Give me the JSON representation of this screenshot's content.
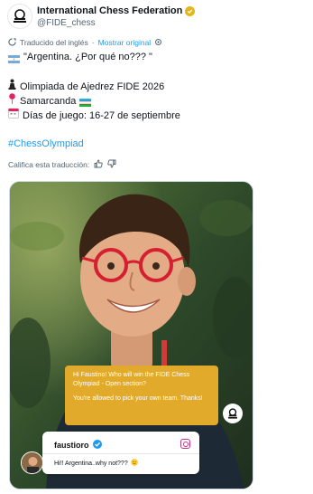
{
  "tweet": {
    "author": {
      "display_name": "International Chess Federation",
      "handle": "@FIDE_chess",
      "avatar_icon": "fide-logo-icon",
      "verified_badge_color": "#e2b719"
    },
    "translation": {
      "label": "Traducido del inglés",
      "link": "Mostrar original",
      "icon": "translate-icon",
      "settings_icon": "gear-icon"
    },
    "lines": {
      "quote": "\"Argentina. ¿Por qué no??? \"",
      "olympiad": "Olimpiada de Ajedrez FIDE 2026",
      "city": "Samarcanda",
      "dates": "Días de juego: 16-27 de septiembre",
      "hashtag": "#ChessOlympiad"
    },
    "rate": {
      "label": "Califica esta traducción:",
      "like_icon": "thumbs-up-icon",
      "dislike_icon": "thumbs-down-icon"
    }
  },
  "media": {
    "question_card": {
      "line1": "Hi Faustino! Who will win the FIDE Chess Olympiad - Open section?",
      "line2": "You're allowed to pick your own team. Thanks!"
    },
    "answer_card": {
      "username": "faustioro",
      "text": "Hi!! Argentina..why not???"
    }
  },
  "colors": {
    "link": "#1d9bf0",
    "muted": "#536471",
    "question_card": "#e1aa2a"
  }
}
